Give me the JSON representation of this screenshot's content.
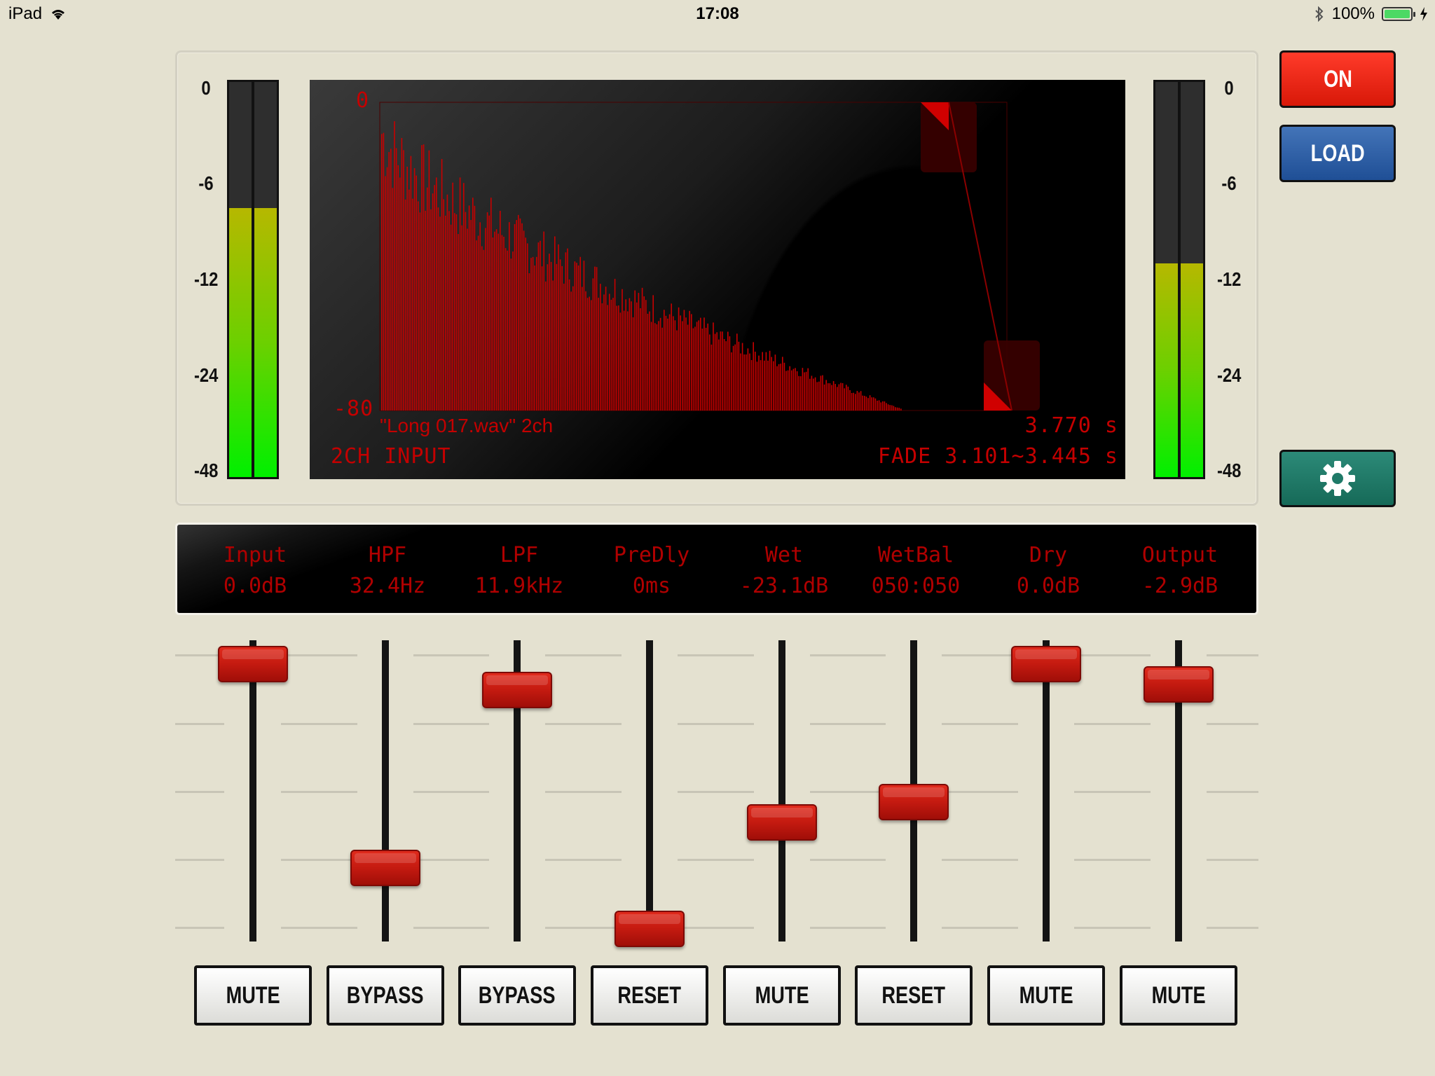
{
  "status_bar": {
    "device": "iPad",
    "time": "17:08",
    "battery": "100%"
  },
  "meter_scale": [
    "0",
    "-6",
    "-12",
    "-24",
    "-48"
  ],
  "meters": {
    "input": {
      "left_level": 0.68,
      "right_level": 0.68
    },
    "output": {
      "left_level": 0.54,
      "right_level": 0.54
    }
  },
  "display": {
    "axis_top": "0",
    "axis_bottom": "-80",
    "file_name": "\"Long 017.wav\" 2ch",
    "length": "3.770 s",
    "mode": "2CH INPUT",
    "fade": "FADE 3.101~3.445 s"
  },
  "buttons": {
    "on": "ON",
    "load": "LOAD",
    "settings_icon": "gear-icon"
  },
  "channels": [
    {
      "name": "Input",
      "value": "0.0dB",
      "button": "MUTE",
      "fader": 0.03
    },
    {
      "name": "HPF",
      "value": "32.4Hz",
      "button": "BYPASS",
      "fader": 0.74
    },
    {
      "name": "LPF",
      "value": "11.9kHz",
      "button": "BYPASS",
      "fader": 0.12
    },
    {
      "name": "PreDly",
      "value": "0ms",
      "button": "RESET",
      "fader": 0.95
    },
    {
      "name": "Wet",
      "value": "-23.1dB",
      "button": "MUTE",
      "fader": 0.58
    },
    {
      "name": "WetBal",
      "value": "050:050",
      "button": "RESET",
      "fader": 0.51
    },
    {
      "name": "Dry",
      "value": "0.0dB",
      "button": "MUTE",
      "fader": 0.03
    },
    {
      "name": "Output",
      "value": "-2.9dB",
      "button": "MUTE",
      "fader": 0.1
    }
  ],
  "colors": {
    "on_button": "#e8200f",
    "load_button": "#2a5ea6",
    "settings_button": "#1f7a68",
    "led_red": "#c40000",
    "fader_knob": "#c41a10"
  }
}
